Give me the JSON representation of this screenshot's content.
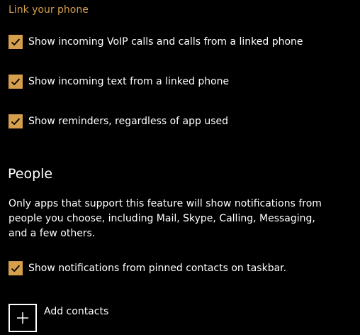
{
  "link_phone": {
    "header": "Link your phone",
    "options": [
      {
        "label": "Show incoming VoIP calls and calls from a linked phone",
        "checked": true
      },
      {
        "label": "Show incoming text from a linked phone",
        "checked": true
      },
      {
        "label": "Show reminders, regardless of app used",
        "checked": true
      }
    ]
  },
  "people": {
    "title": "People",
    "description": "Only apps that support this feature will show notifications from people you choose, including Mail, Skype, Calling, Messaging, and a few others.",
    "pinned_option": {
      "label": "Show notifications from pinned contacts on taskbar.",
      "checked": true
    },
    "add_contacts_label": "Add contacts"
  },
  "theme": {
    "accent": "#d69f4c",
    "background": "#000000",
    "text": "#ffffff"
  },
  "icons": {
    "checkmark": "checkmark-icon",
    "add": "plus-icon"
  }
}
